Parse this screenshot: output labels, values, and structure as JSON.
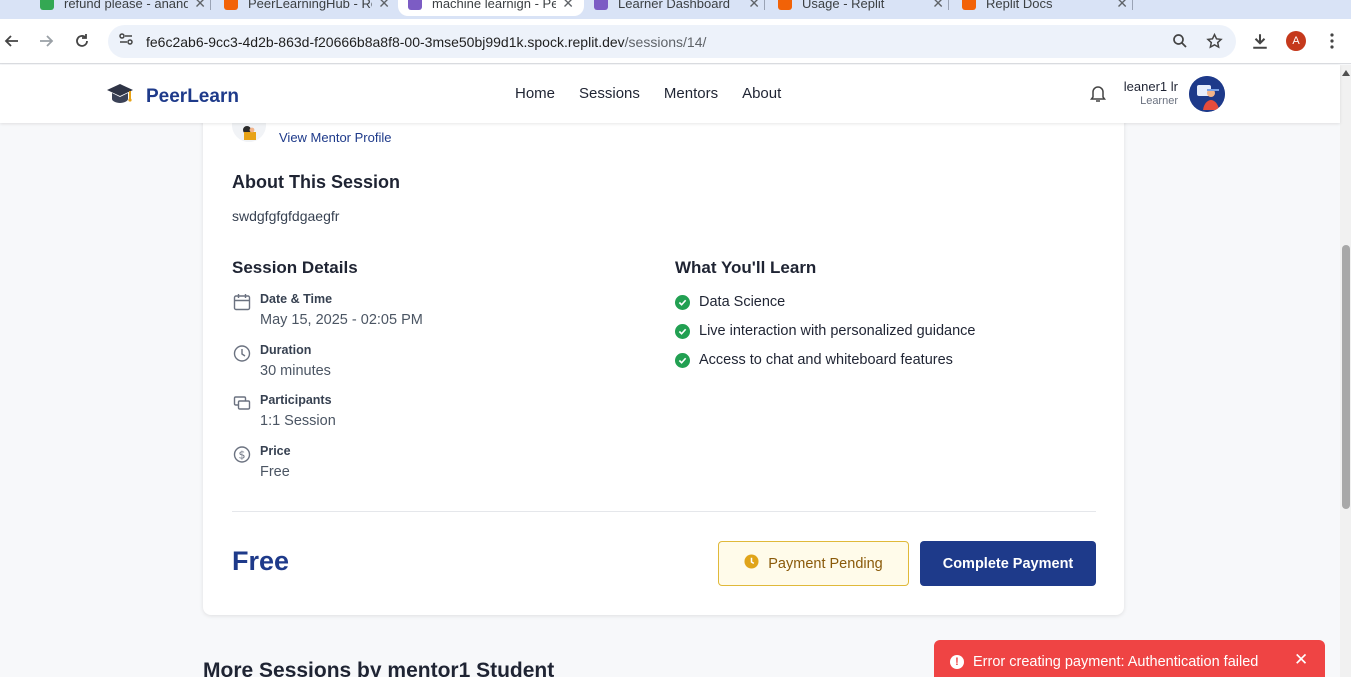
{
  "browser": {
    "tabs": [
      {
        "title": "refund please - anand",
        "favicon_color": "#34a853",
        "active": false
      },
      {
        "title": "PeerLearningHub - Re",
        "favicon_color": "#f26207",
        "active": false
      },
      {
        "title": "machine learnign - Pe",
        "favicon_color": "#7c5cc4",
        "active": true
      },
      {
        "title": "Learner Dashboard",
        "favicon_color": "#7c5cc4",
        "active": false
      },
      {
        "title": "Usage - Replit",
        "favicon_color": "#f26207",
        "active": false
      },
      {
        "title": "Replit Docs",
        "favicon_color": "#f26207",
        "active": false
      }
    ],
    "url_host": "fe6c2ab6-9cc3-4d2b-863d-f20666b8a8f8-00-3mse50bj99d1k.spock.replit.dev",
    "url_path": "/sessions/14/",
    "profile_initial": "A"
  },
  "header": {
    "brand": "PeerLearn",
    "nav": [
      "Home",
      "Sessions",
      "Mentors",
      "About"
    ],
    "user_name": "leaner1 lr",
    "user_role": "Learner"
  },
  "session": {
    "mentor_link": "View Mentor Profile",
    "about_heading": "About This Session",
    "about_text": "swdgfgfgfdgaegfr",
    "details_heading": "Session Details",
    "details": [
      {
        "icon": "calendar-icon",
        "label": "Date & Time",
        "value": "May 15, 2025 - 02:05 PM"
      },
      {
        "icon": "clock-icon",
        "label": "Duration",
        "value": "30 minutes"
      },
      {
        "icon": "participants-icon",
        "label": "Participants",
        "value": "1:1 Session"
      },
      {
        "icon": "dollar-icon",
        "label": "Price",
        "value": "Free"
      }
    ],
    "learn_heading": "What You'll Learn",
    "learn_items": [
      "Data Science",
      "Live interaction with personalized guidance",
      "Access to chat and whiteboard features"
    ],
    "price_display": "Free",
    "pending_label": "Payment Pending",
    "complete_label": "Complete Payment"
  },
  "more_sessions_heading": "More Sessions by mentor1 Student",
  "toast": {
    "message": "Error creating payment: Authentication failed",
    "color": "#ef4444"
  },
  "colors": {
    "brand": "#1e3a8a",
    "success": "#22a052",
    "warning_border": "#e0b93a"
  }
}
